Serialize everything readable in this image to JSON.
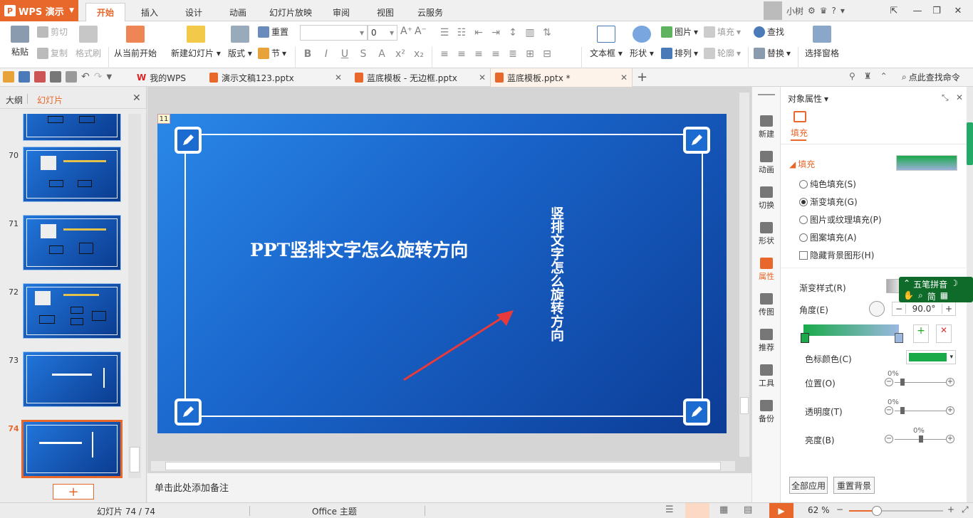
{
  "app": {
    "name": "WPS 演示",
    "logo_glyph": "P"
  },
  "menu_tabs": [
    "开始",
    "插入",
    "设计",
    "动画",
    "幻灯片放映",
    "审阅",
    "视图",
    "云服务"
  ],
  "user": {
    "name": "小树"
  },
  "ribbon": {
    "paste": "粘贴",
    "cut": "剪切",
    "copy": "复制",
    "format_painter": "格式刷",
    "from_current": "从当前开始",
    "new_slide": "新建幻灯片",
    "layout": "版式",
    "reset": "重置",
    "section": "节",
    "font_size": "0",
    "textbox": "文本框",
    "shape": "形状",
    "picture": "图片",
    "fill": "填充",
    "arrange": "排列",
    "outline": "轮廓",
    "find": "查找",
    "replace": "替换",
    "selection_pane": "选择窗格"
  },
  "doc_tabs": [
    {
      "label": "我的WPS"
    },
    {
      "label": "演示文稿123.pptx"
    },
    {
      "label": "蓝底模板 - 无边框.pptx"
    },
    {
      "label": "蓝底模板.pptx *"
    }
  ],
  "search_cmd": "点此查找命令",
  "left_panel": {
    "tab_outline": "大纲",
    "tab_slides": "幻灯片",
    "thumbs": [
      {
        "num": ""
      },
      {
        "num": "70"
      },
      {
        "num": "71"
      },
      {
        "num": "72"
      },
      {
        "num": "73"
      },
      {
        "num": "74"
      }
    ],
    "add_button": "+"
  },
  "slide": {
    "number": "11",
    "title": "PPT竖排文字怎么旋转方向",
    "vertical_text": "竖排文字怎么旋转方向"
  },
  "notes": {
    "placeholder": "单击此处添加备注"
  },
  "side_tools": [
    "新建",
    "动画",
    "切换",
    "形状",
    "属性",
    "传图",
    "推荐",
    "工具",
    "备份"
  ],
  "properties": {
    "header": "对象属性",
    "tab": "填充",
    "section": "填充",
    "options": [
      {
        "label": "纯色填充(S)",
        "selected": false
      },
      {
        "label": "渐变填充(G)",
        "selected": true
      },
      {
        "label": "图片或纹理填充(P)",
        "selected": false
      },
      {
        "label": "图案填充(A)",
        "selected": false
      }
    ],
    "hide_bg": "隐藏背景图形(H)",
    "gradient_style": "渐变样式(R)",
    "angle_label": "角度(E)",
    "angle_value": "90.0°",
    "stop_color_label": "色标颜色(C)",
    "stop_color": "#1aaa4a",
    "position_label": "位置(O)",
    "position_value": "0%",
    "transparency_label": "透明度(T)",
    "transparency_value": "0%",
    "brightness_label": "亮度(B)",
    "brightness_value": "0%",
    "apply_all": "全部应用",
    "reset_bg": "重置背景"
  },
  "ime": {
    "name": "五笔拼音",
    "mode": "简"
  },
  "status": {
    "slide_info": "幻灯片 74 / 74",
    "theme": "Office 主题",
    "zoom": "62 %"
  },
  "colors": {
    "accent": "#e8672a",
    "slide_blue": "#1a66cc",
    "arrow_red": "#e83a3a"
  }
}
